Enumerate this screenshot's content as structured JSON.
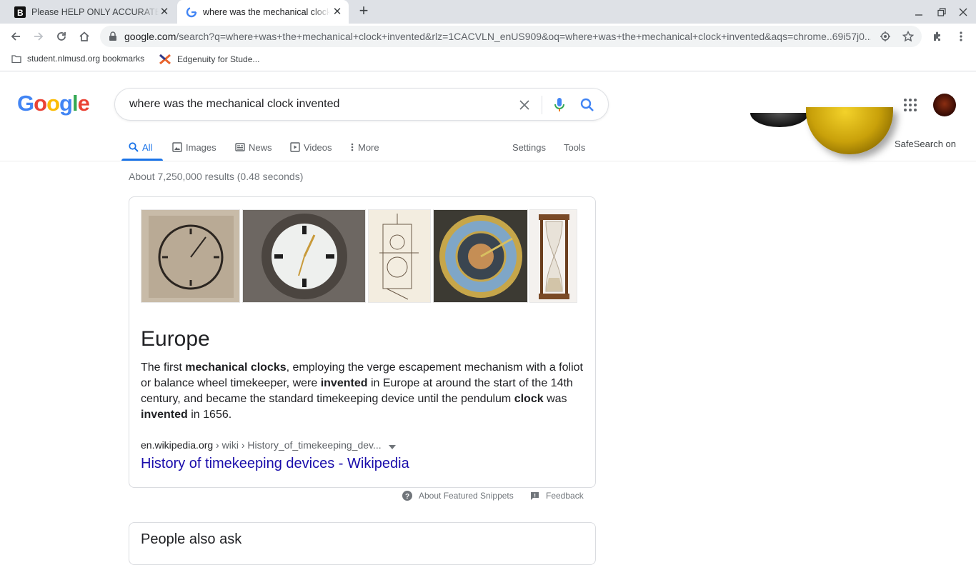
{
  "browser": {
    "tabs": [
      {
        "title": "Please HELP ONLY ACCURATE ANSWERS",
        "favicon": "brainly-icon"
      },
      {
        "title": "where was the mechanical clock invented - Google Search",
        "favicon": "google-icon"
      }
    ],
    "url_host": "google.com",
    "url_rest": "/search?q=where+was+the+mechanical+clock+invented&rlz=1CACVLN_enUS909&oq=where+was+the+mechanical+clock+invented&aqs=chrome..69i57j0...",
    "bookmarks": [
      {
        "label": "student.nlmusd.org bookmarks",
        "icon": "folder-icon"
      },
      {
        "label": "Edgenuity for Stude...",
        "icon": "edgenuity-icon"
      }
    ]
  },
  "google": {
    "logo_letters": [
      "G",
      "o",
      "o",
      "g",
      "l",
      "e"
    ],
    "logo_colors": [
      "#4285f4",
      "#ea4335",
      "#fbbc05",
      "#4285f4",
      "#34a853",
      "#ea4335"
    ],
    "query": "where was the mechanical clock invented",
    "safesearch": "SafeSearch on",
    "nav": {
      "all": "All",
      "images": "Images",
      "news": "News",
      "videos": "Videos",
      "more": "More",
      "settings": "Settings",
      "tools": "Tools"
    },
    "stats": "About 7,250,000 results (0.48 seconds)",
    "snippet": {
      "answer": "Europe",
      "text_parts": [
        "The first ",
        "mechanical clocks",
        ", employing the verge escapement mechanism with a foliot or balance wheel timekeeper, were ",
        "invented",
        " in Europe at around the start of the 14th century, and became the standard timekeeping device until the pendulum ",
        "clock",
        " was ",
        "invented",
        " in 1656."
      ],
      "cite_host": "en.wikipedia.org",
      "cite_path": " › wiki › History_of_timekeeping_dev...",
      "title": "History of timekeeping devices - Wikipedia"
    },
    "about_snippets": "About Featured Snippets",
    "feedback": "Feedback",
    "people_also_ask": "People also ask"
  },
  "colors": {
    "accent": "#1a73e8",
    "link": "#1a0dab",
    "chrome_bg": "#dee1e6"
  }
}
